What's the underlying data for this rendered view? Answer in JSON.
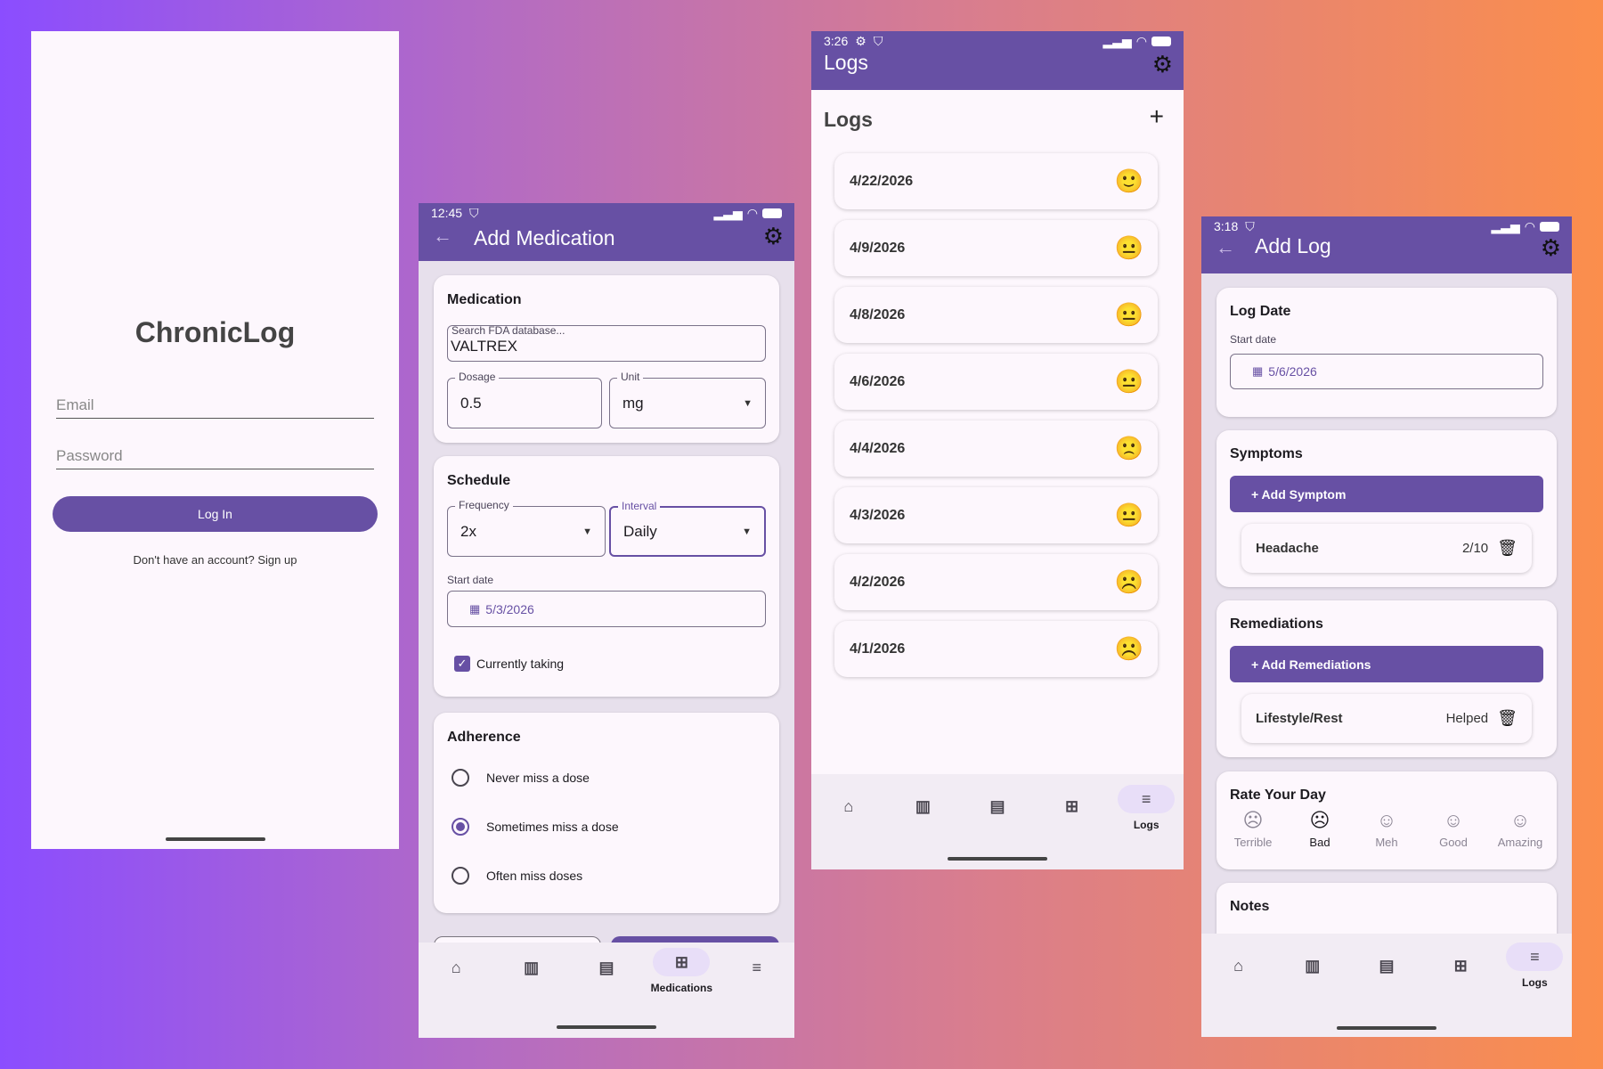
{
  "login": {
    "title": "ChronicLog",
    "email_placeholder": "Email",
    "password_placeholder": "Password",
    "login_button": "Log In",
    "signup_text": "Don't have an account? Sign up"
  },
  "add_med": {
    "status": {
      "time": "12:45"
    },
    "title": "Add Medication",
    "medication": {
      "heading": "Medication",
      "search_label": "Search FDA database...",
      "search_value": "VALTREX",
      "dosage_label": "Dosage",
      "dosage_value": "0.5",
      "unit_label": "Unit",
      "unit_value": "mg"
    },
    "schedule": {
      "heading": "Schedule",
      "frequency_label": "Frequency",
      "frequency_value": "2x",
      "interval_label": "Interval",
      "interval_value": "Daily",
      "start_label": "Start date",
      "start_value": "5/3/2026",
      "currently_taking": "Currently taking"
    },
    "adherence": {
      "heading": "Adherence",
      "options": [
        "Never miss a dose",
        "Sometimes miss a dose",
        "Often miss doses"
      ],
      "selected": 1
    },
    "nav": {
      "active_label": "Medications"
    }
  },
  "logs": {
    "status": {
      "time": "3:26"
    },
    "title": "Logs",
    "heading": "Logs",
    "entries": [
      {
        "date": "4/22/2026",
        "mood": "🙂"
      },
      {
        "date": "4/9/2026",
        "mood": "😐"
      },
      {
        "date": "4/8/2026",
        "mood": "😐"
      },
      {
        "date": "4/6/2026",
        "mood": "😐"
      },
      {
        "date": "4/4/2026",
        "mood": "🙁"
      },
      {
        "date": "4/3/2026",
        "mood": "😐"
      },
      {
        "date": "4/2/2026",
        "mood": "☹️"
      },
      {
        "date": "4/1/2026",
        "mood": "☹️"
      }
    ],
    "nav": {
      "active_label": "Logs"
    }
  },
  "add_log": {
    "status": {
      "time": "3:18"
    },
    "title": "Add Log",
    "log_date": {
      "heading": "Log Date",
      "start_label": "Start date",
      "value": "5/6/2026"
    },
    "symptoms": {
      "heading": "Symptoms",
      "add_button": "+ Add Symptom",
      "items": [
        {
          "name": "Headache",
          "value": "2/10"
        }
      ]
    },
    "remediations": {
      "heading": "Remediations",
      "add_button": "+ Add Remediations",
      "items": [
        {
          "name": "Lifestyle/Rest",
          "value": "Helped"
        }
      ]
    },
    "rate": {
      "heading": "Rate Your Day",
      "options": [
        "Terrible",
        "Bad",
        "Meh",
        "Good",
        "Amazing"
      ],
      "selected": 1
    },
    "notes": {
      "heading": "Notes"
    },
    "nav": {
      "active_label": "Logs"
    }
  },
  "colors": {
    "primary": "#6750a4",
    "surface": "#fdf7fd",
    "container": "#e7e0ec"
  }
}
